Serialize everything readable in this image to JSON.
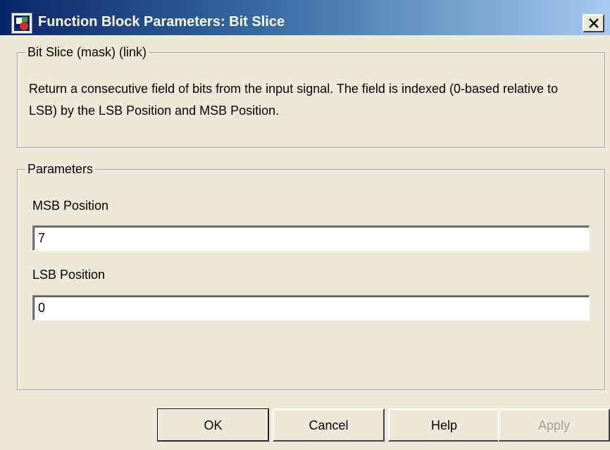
{
  "window": {
    "title": "Function Block Parameters: Bit Slice"
  },
  "mask_group": {
    "legend": "Bit Slice (mask) (link)",
    "description": "Return a consecutive field of bits from the input signal. The field is indexed (0-based relative to LSB) by the LSB Position and MSB Position."
  },
  "params_group": {
    "legend": "Parameters",
    "msb": {
      "label": "MSB Position",
      "value": "7"
    },
    "lsb": {
      "label": "LSB Position",
      "value": "0"
    }
  },
  "buttons": {
    "ok": "OK",
    "cancel": "Cancel",
    "help": "Help",
    "apply": "Apply"
  },
  "icons": {
    "app": "simulink-block-icon",
    "close": "close-icon"
  },
  "colors": {
    "titlebar_start": "#0a246a",
    "titlebar_end": "#a6caf0",
    "dialog_bg": "#ece9d8"
  }
}
